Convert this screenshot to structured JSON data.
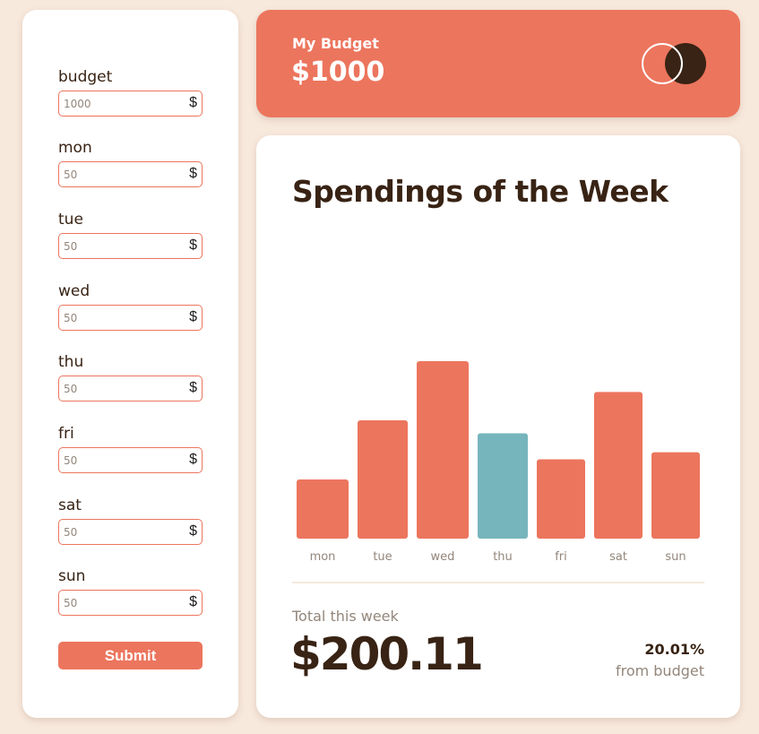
{
  "form": {
    "fields": [
      {
        "label": "budget",
        "value": "1000",
        "currency": "$"
      },
      {
        "label": "mon",
        "value": "50",
        "currency": "$"
      },
      {
        "label": "tue",
        "value": "50",
        "currency": "$"
      },
      {
        "label": "wed",
        "value": "50",
        "currency": "$"
      },
      {
        "label": "thu",
        "value": "50",
        "currency": "$"
      },
      {
        "label": "fri",
        "value": "50",
        "currency": "$"
      },
      {
        "label": "sat",
        "value": "50",
        "currency": "$"
      },
      {
        "label": "sun",
        "value": "50",
        "currency": "$"
      }
    ],
    "submit_label": "Submit"
  },
  "balance": {
    "label": "My Budget",
    "amount": "$1000",
    "logo_icon": "two-circles-logo-icon"
  },
  "spending": {
    "title": "Spendings of the Week",
    "total_label": "Total this week",
    "total_amount": "$200.11",
    "percent": "20.01%",
    "percent_sub": "from budget"
  },
  "colors": {
    "accent": "#ec755d",
    "highlight": "#76b5bc",
    "dark": "#382314",
    "muted": "#93867b",
    "background": "#f8e9dd"
  },
  "chart_data": {
    "type": "bar",
    "categories": [
      "mon",
      "tue",
      "wed",
      "thu",
      "fri",
      "sat",
      "sun"
    ],
    "values": [
      17.45,
      34.91,
      52.36,
      31.07,
      23.39,
      43.28,
      25.48
    ],
    "highlight_index": 3,
    "title": "",
    "xlabel": "",
    "ylabel": "",
    "grid": false
  }
}
